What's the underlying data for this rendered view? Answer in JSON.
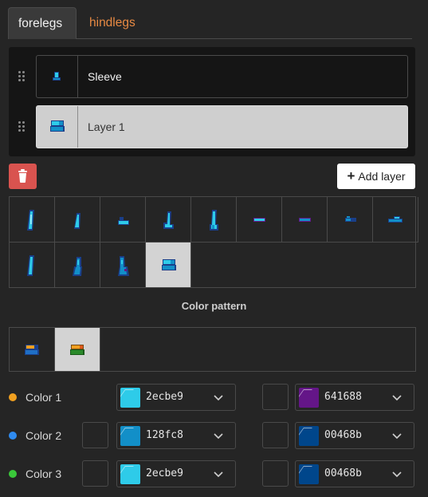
{
  "tabs": [
    {
      "label": "forelegs",
      "active": true
    },
    {
      "label": "hindlegs",
      "active": false
    }
  ],
  "layers": [
    {
      "name": "Sleeve",
      "selected": false,
      "icon": "sleeve-sprite-icon"
    },
    {
      "name": "Layer 1",
      "selected": true,
      "icon": "boot-sprite-icon"
    }
  ],
  "actions": {
    "delete_icon": "trash-icon",
    "add_layer_icon": "plus-icon",
    "add_layer_label": "Add layer"
  },
  "sprite_grid": {
    "rows": 2,
    "columns": 9,
    "items": [
      "leg-sprite-1-icon",
      "leg-sprite-2-icon",
      "hoof-sprite-icon",
      "leg-sprite-3-icon",
      "leg-sprite-4-icon",
      "band-sprite-1-icon",
      "band-sprite-2-icon",
      "band-sprite-3-icon",
      "band-sprite-4-icon",
      "leg-sprite-5-icon",
      "leg-sprite-6-icon",
      "leg-sprite-7-icon",
      "boot-sprite-icon"
    ],
    "selected_index": 12
  },
  "color_pattern": {
    "title": "Color pattern",
    "items": [
      "pattern-1-icon",
      "pattern-2-icon"
    ],
    "selected_index": 1,
    "pattern_colors": [
      [
        "#1f6fc6",
        "#f0a020"
      ],
      [
        "#2a8a2a",
        "#f0a020",
        "#e05a1a"
      ]
    ]
  },
  "color_rows": [
    {
      "label": "Color 1",
      "dot": "#f0a020",
      "primary": {
        "hex": "2ecbe9",
        "color": "#2ecbe9"
      },
      "secondary": {
        "hex": "641688",
        "color": "#641688"
      }
    },
    {
      "label": "Color 2",
      "dot": "#2f8bf0",
      "primary": {
        "hex": "128fc8",
        "color": "#128fc8"
      },
      "secondary": {
        "hex": "00468b",
        "color": "#00468b"
      }
    },
    {
      "label": "Color 3",
      "dot": "#3ac83a",
      "primary": {
        "hex": "2ecbe9",
        "color": "#2ecbe9"
      },
      "secondary": {
        "hex": "00468b",
        "color": "#00468b"
      }
    }
  ],
  "colors": {
    "accent_orange": "#e88a43",
    "danger": "#d9534f",
    "background": "#252525",
    "panel": "#151515"
  }
}
